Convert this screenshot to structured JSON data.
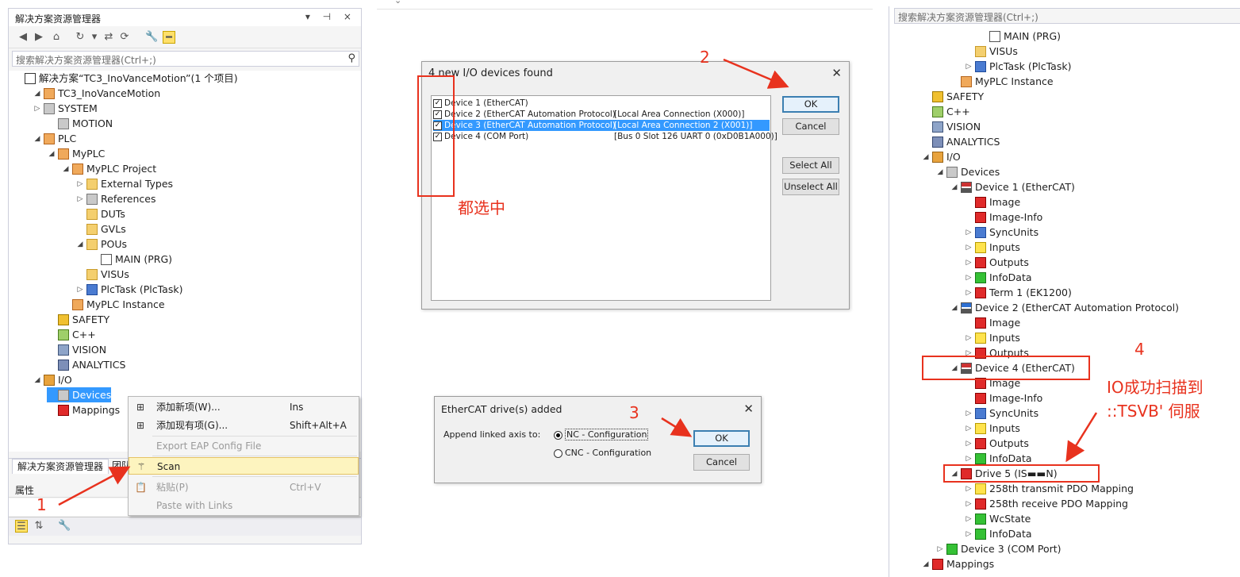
{
  "left": {
    "title": "解决方案资源管理器",
    "title_pins": "▾ ⊣ ×",
    "search_placeholder": "搜索解决方案资源管理器(Ctrl+;)",
    "tree": [
      {
        "label": "解决方案“TC3_InoVanceMotion”(1 个项目)",
        "icon": "solution-icon",
        "exp": ""
      },
      {
        "label": "TC3_InoVanceMotion",
        "icon": "project-icon",
        "exp": "◢"
      },
      {
        "label": "SYSTEM",
        "icon": "system-icon",
        "exp": "▷"
      },
      {
        "label": "MOTION",
        "icon": "motion-icon",
        "exp": ""
      },
      {
        "label": "PLC",
        "icon": "plc-icon",
        "exp": "◢"
      },
      {
        "label": "MyPLC",
        "icon": "plc-icon",
        "exp": "◢"
      },
      {
        "label": "MyPLC Project",
        "icon": "plc-project-icon",
        "exp": "◢"
      },
      {
        "label": "External Types",
        "icon": "folder-icon",
        "exp": "▷"
      },
      {
        "label": "References",
        "icon": "references-icon",
        "exp": "▷"
      },
      {
        "label": "DUTs",
        "icon": "folder-icon",
        "exp": ""
      },
      {
        "label": "GVLs",
        "icon": "folder-icon",
        "exp": ""
      },
      {
        "label": "POUs",
        "icon": "folder-open-icon",
        "exp": "◢"
      },
      {
        "label": "MAIN (PRG)",
        "icon": "program-icon",
        "exp": ""
      },
      {
        "label": "VISUs",
        "icon": "folder-icon",
        "exp": ""
      },
      {
        "label": "PlcTask (PlcTask)",
        "icon": "task-icon",
        "exp": "▷"
      },
      {
        "label": "MyPLC Instance",
        "icon": "instance-icon",
        "exp": ""
      },
      {
        "label": "SAFETY",
        "icon": "safety-icon",
        "exp": ""
      },
      {
        "label": "C++",
        "icon": "cpp-icon",
        "exp": ""
      },
      {
        "label": "VISION",
        "icon": "vision-icon",
        "exp": ""
      },
      {
        "label": "ANALYTICS",
        "icon": "analytics-icon",
        "exp": ""
      },
      {
        "label": "I/O",
        "icon": "io-icon",
        "exp": "◢"
      },
      {
        "label": "Devices",
        "icon": "devices-icon",
        "exp": ""
      },
      {
        "label": "Mappings",
        "icon": "mappings-icon",
        "exp": ""
      }
    ],
    "tabs": [
      "解决方案资源管理器",
      "团队"
    ],
    "props_title": "属性"
  },
  "context_menu": {
    "items": [
      {
        "label": "添加新项(W)...",
        "key": "Ins",
        "disabled": false
      },
      {
        "label": "添加现有项(G)...",
        "key": "Shift+Alt+A",
        "disabled": false
      },
      {
        "label": "Export EAP Config File",
        "key": "",
        "disabled": true
      },
      {
        "label": "Scan",
        "key": "",
        "disabled": false
      },
      {
        "label": "粘贴(P)",
        "key": "Ctrl+V",
        "disabled": true
      },
      {
        "label": "Paste with Links",
        "key": "",
        "disabled": true
      }
    ]
  },
  "dialog1": {
    "title": "4 new I/O devices found",
    "devices": [
      {
        "name": "Device 1 (EtherCAT)",
        "info": ""
      },
      {
        "name": "Device 2 (EtherCAT Automation Protocol)",
        "info": "[Local Area Connection (X000)]"
      },
      {
        "name": "Device 3 (EtherCAT Automation Protocol)",
        "info": "[Local Area Connection 2 (X001)]"
      },
      {
        "name": "Device 4 (COM Port)",
        "info": "[Bus 0 Slot 126 UART 0 (0xD0B1A000)]"
      }
    ],
    "ok": "OK",
    "cancel": "Cancel",
    "select_all": "Select All",
    "unselect_all": "Unselect All"
  },
  "dialog2": {
    "title": "EtherCAT drive(s) added",
    "append_label": "Append linked axis to:",
    "option_nc": "NC - Configuration",
    "option_cnc": "CNC - Configuration",
    "ok": "OK",
    "cancel": "Cancel"
  },
  "annotations": {
    "n1": "1",
    "n2": "2",
    "n3": "3",
    "n4": "4",
    "select_all_note": "都选中",
    "success_line1": "IO成功扫描到",
    "success_line2": "::TSVB' 伺服"
  },
  "right": {
    "search_placeholder": "搜索解决方案资源管理器(Ctrl+;)",
    "tree": [
      {
        "label": "MAIN (PRG)",
        "icon": "program-icon",
        "exp": ""
      },
      {
        "label": "VISUs",
        "icon": "folder-icon",
        "exp": ""
      },
      {
        "label": "PlcTask (PlcTask)",
        "icon": "task-icon",
        "exp": "▷"
      },
      {
        "label": "MyPLC Instance",
        "icon": "instance-icon",
        "exp": ""
      },
      {
        "label": "SAFETY",
        "icon": "safety-icon",
        "exp": ""
      },
      {
        "label": "C++",
        "icon": "cpp-icon",
        "exp": ""
      },
      {
        "label": "VISION",
        "icon": "vision-icon",
        "exp": ""
      },
      {
        "label": "ANALYTICS",
        "icon": "analytics-icon",
        "exp": ""
      },
      {
        "label": "I/O",
        "icon": "io-icon",
        "exp": "◢"
      },
      {
        "label": "Devices",
        "icon": "devices-icon",
        "exp": "◢"
      },
      {
        "label": "Device 1 (EtherCAT)",
        "icon": "ethercat-device-icon",
        "exp": "◢"
      },
      {
        "label": "Image",
        "icon": "image-icon",
        "exp": ""
      },
      {
        "label": "Image-Info",
        "icon": "image-info-icon",
        "exp": ""
      },
      {
        "label": "SyncUnits",
        "icon": "syncunits-icon",
        "exp": "▷"
      },
      {
        "label": "Inputs",
        "icon": "inputs-icon",
        "exp": "▷"
      },
      {
        "label": "Outputs",
        "icon": "outputs-icon",
        "exp": "▷"
      },
      {
        "label": "InfoData",
        "icon": "infodata-icon",
        "exp": "▷"
      },
      {
        "label": "Term 1 (EK1200)",
        "icon": "terminal-icon",
        "exp": "▷"
      },
      {
        "label": "Device 2 (EtherCAT Automation Protocol)",
        "icon": "eap-device-icon",
        "exp": "◢"
      },
      {
        "label": "Image",
        "icon": "image-icon",
        "exp": ""
      },
      {
        "label": "Inputs",
        "icon": "inputs-icon",
        "exp": "▷"
      },
      {
        "label": "Outputs",
        "icon": "outputs-icon",
        "exp": "▷"
      },
      {
        "label": "Device 4 (EtherCAT)",
        "icon": "ethercat-device-icon",
        "exp": "◢"
      },
      {
        "label": "Image",
        "icon": "image-icon",
        "exp": ""
      },
      {
        "label": "Image-Info",
        "icon": "image-info-icon",
        "exp": ""
      },
      {
        "label": "SyncUnits",
        "icon": "syncunits-icon",
        "exp": "▷"
      },
      {
        "label": "Inputs",
        "icon": "inputs-icon",
        "exp": "▷"
      },
      {
        "label": "Outputs",
        "icon": "outputs-icon",
        "exp": "▷"
      },
      {
        "label": "InfoData",
        "icon": "infodata-icon",
        "exp": "▷"
      },
      {
        "label": "Drive 5 (IS▬▬N)",
        "icon": "drive-icon",
        "exp": "◢"
      },
      {
        "label": "258th transmit PDO Mapping",
        "icon": "inputs-icon",
        "exp": "▷"
      },
      {
        "label": "258th receive PDO Mapping",
        "icon": "outputs-icon",
        "exp": "▷"
      },
      {
        "label": "WcState",
        "icon": "infodata-icon",
        "exp": "▷"
      },
      {
        "label": "InfoData",
        "icon": "infodata-icon",
        "exp": "▷"
      },
      {
        "label": "Device 3 (COM Port)",
        "icon": "com-device-icon",
        "exp": "▷"
      },
      {
        "label": "Mappings",
        "icon": "mappings-icon",
        "exp": "◢"
      }
    ]
  },
  "colors": {
    "selection": "#3399ff",
    "annotation": "#e8321e",
    "menu_hot": "#fdf4bf"
  }
}
